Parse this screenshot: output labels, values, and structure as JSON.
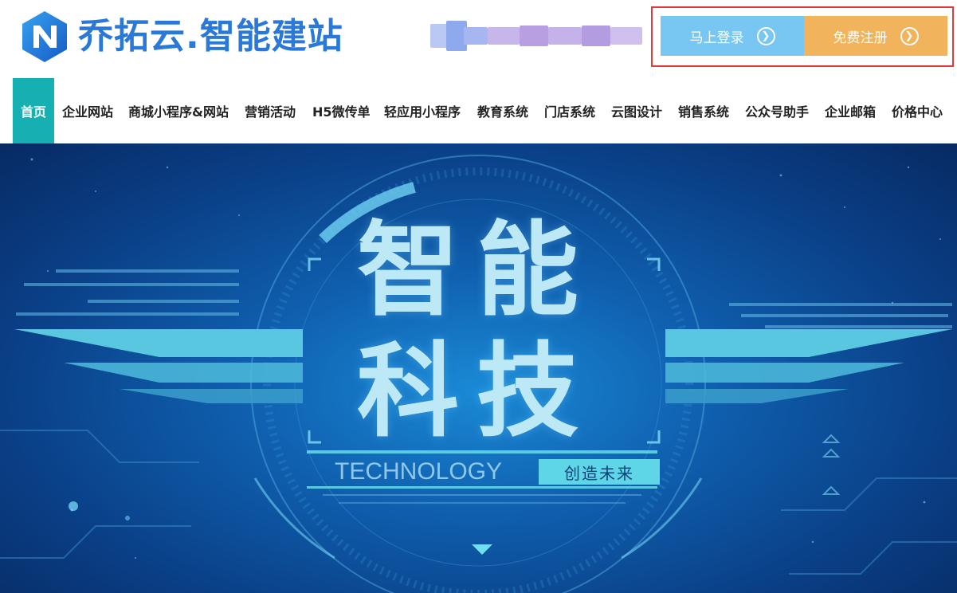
{
  "header": {
    "logo_text": "乔拓云.智能建站",
    "login_label": "马上登录",
    "register_label": "免费注册"
  },
  "nav": {
    "items": [
      {
        "label": "首页",
        "active": true
      },
      {
        "label": "企业网站"
      },
      {
        "label": "商城小程序&网站"
      },
      {
        "label": "营销活动"
      },
      {
        "label": "H5微传单"
      },
      {
        "label": "轻应用小程序"
      },
      {
        "label": "教育系统"
      },
      {
        "label": "门店系统"
      },
      {
        "label": "云图设计"
      },
      {
        "label": "销售系统"
      },
      {
        "label": "公众号助手"
      },
      {
        "label": "企业邮箱"
      },
      {
        "label": "价格中心"
      }
    ]
  },
  "banner": {
    "line1": "智能",
    "line2": "科技",
    "technology": "TECHNOLOGY",
    "tagline": "创造未来"
  },
  "colors": {
    "brand_blue": "#2a78d8",
    "nav_active": "#16b0b3",
    "login_bg": "#77c7f2",
    "register_bg": "#f2b35d",
    "highlight_border": "#e23a3a"
  },
  "icons": {
    "logo": "logo-n-icon",
    "arrow": "chevron-right-circle-icon"
  }
}
